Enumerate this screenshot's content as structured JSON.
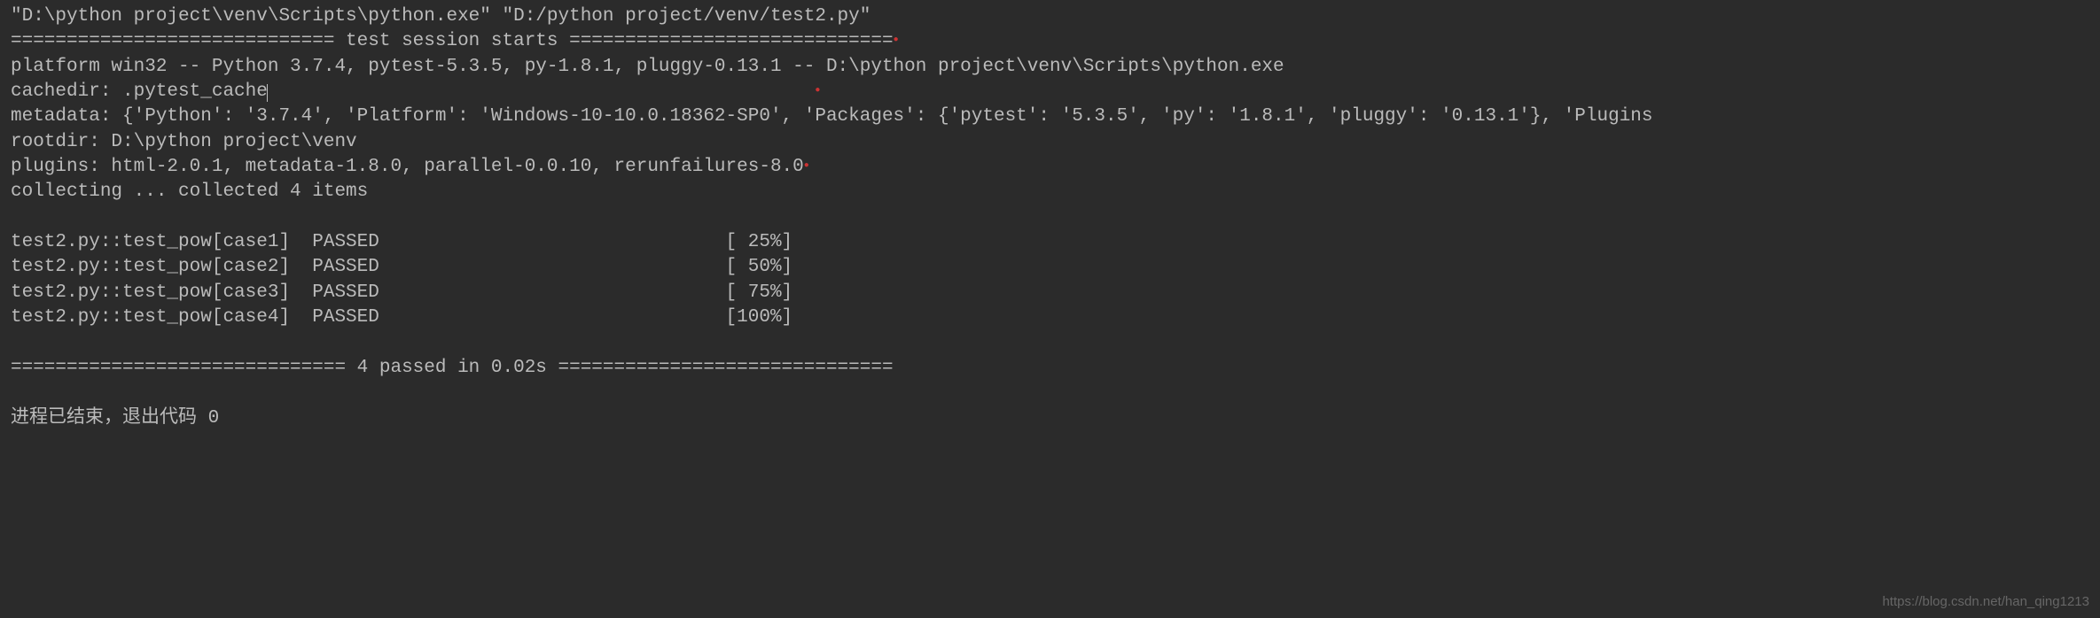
{
  "command": "\"D:\\python project\\venv\\Scripts\\python.exe\" \"D:/python project/venv/test2.py\"",
  "session_header": "============================= test session starts =============================",
  "platform_line": "platform win32 -- Python 3.7.4, pytest-5.3.5, py-1.8.1, pluggy-0.13.1 -- D:\\python project\\venv\\Scripts\\python.exe",
  "cachedir_line": "cachedir: .pytest_cache",
  "metadata_line": "metadata: {'Python': '3.7.4', 'Platform': 'Windows-10-10.0.18362-SP0', 'Packages': {'pytest': '5.3.5', 'py': '1.8.1', 'pluggy': '0.13.1'}, 'Plugins",
  "rootdir_line": "rootdir: D:\\python project\\venv",
  "plugins_line": "plugins: html-2.0.1, metadata-1.8.0, parallel-0.0.10, rerunfailures-8.0",
  "collecting_line": "collecting ... collected 4 items",
  "test_results": [
    {
      "name": "test2.py::test_pow[case1]  PASSED",
      "pct": "[ 25%]"
    },
    {
      "name": "test2.py::test_pow[case2]  PASSED",
      "pct": "[ 50%]"
    },
    {
      "name": "test2.py::test_pow[case3]  PASSED",
      "pct": "[ 75%]"
    },
    {
      "name": "test2.py::test_pow[case4]  PASSED",
      "pct": "[100%]"
    }
  ],
  "summary_line": "============================== 4 passed in 0.02s ==============================",
  "exit_line": "进程已结束，退出代码 0",
  "watermark": "https://blog.csdn.net/han_qing1213"
}
